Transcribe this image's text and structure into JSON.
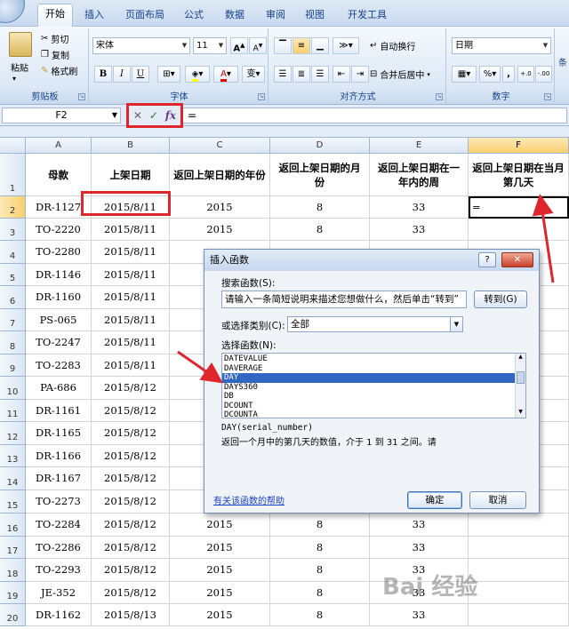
{
  "tabs": [
    "开始",
    "插入",
    "页面布局",
    "公式",
    "数据",
    "审阅",
    "视图",
    "开发工具"
  ],
  "ribbon": {
    "clipboard": {
      "paste": "粘贴",
      "cut": "剪切",
      "copy": "复制",
      "format_painter": "格式刷",
      "label": "剪贴板"
    },
    "font": {
      "name": "宋体",
      "size": "11",
      "bold": "B",
      "italic": "I",
      "underline": "U",
      "grow": "A",
      "shrink": "A",
      "wen": "变",
      "label": "字体"
    },
    "alignment": {
      "wrap": "自动换行",
      "merge": "合并后居中",
      "label": "对齐方式"
    },
    "number": {
      "format": "日期",
      "percent": "%",
      "comma": ",",
      "inc": "+.0",
      "dec": "-.00",
      "label": "数字"
    },
    "more": "条"
  },
  "formula_bar": {
    "cell_ref": "F2",
    "cancel": "✕",
    "enter": "✓",
    "fx": "fx",
    "formula": "="
  },
  "columns": [
    "A",
    "B",
    "C",
    "D",
    "E",
    "F"
  ],
  "headers": [
    "母款",
    "上架日期",
    "返回上架日期的年份",
    "返回上架日期的月份",
    "返回上架日期在一年内的周",
    "返回上架日期在当月第几天"
  ],
  "rows": [
    {
      "n": "1"
    },
    {
      "n": "2",
      "a": "DR-1127",
      "b": "2015/8/11",
      "c": "2015",
      "d": "8",
      "e": "33",
      "f": "="
    },
    {
      "n": "3",
      "a": "TO-2220",
      "b": "2015/8/11",
      "c": "2015",
      "d": "8",
      "e": "33",
      "f": ""
    },
    {
      "n": "4",
      "a": "TO-2280",
      "b": "2015/8/11"
    },
    {
      "n": "5",
      "a": "DR-1146",
      "b": "2015/8/11"
    },
    {
      "n": "6",
      "a": "DR-1160",
      "b": "2015/8/11"
    },
    {
      "n": "7",
      "a": "PS-065",
      "b": "2015/8/11"
    },
    {
      "n": "8",
      "a": "TO-2247",
      "b": "2015/8/11"
    },
    {
      "n": "9",
      "a": "TO-2283",
      "b": "2015/8/11"
    },
    {
      "n": "10",
      "a": "PA-686",
      "b": "2015/8/12"
    },
    {
      "n": "11",
      "a": "DR-1161",
      "b": "2015/8/12"
    },
    {
      "n": "12",
      "a": "DR-1165",
      "b": "2015/8/12"
    },
    {
      "n": "13",
      "a": "DR-1166",
      "b": "2015/8/12"
    },
    {
      "n": "14",
      "a": "DR-1167",
      "b": "2015/8/12"
    },
    {
      "n": "15",
      "a": "TO-2273",
      "b": "2015/8/12"
    },
    {
      "n": "16",
      "a": "TO-2284",
      "b": "2015/8/12",
      "c": "2015",
      "d": "8",
      "e": "33"
    },
    {
      "n": "17",
      "a": "TO-2286",
      "b": "2015/8/12",
      "c": "2015",
      "d": "8",
      "e": "33"
    },
    {
      "n": "18",
      "a": "TO-2293",
      "b": "2015/8/12",
      "c": "2015",
      "d": "8",
      "e": "33"
    },
    {
      "n": "19",
      "a": "JE-352",
      "b": "2015/8/12",
      "c": "2015",
      "d": "8",
      "e": "33"
    },
    {
      "n": "20",
      "a": "DR-1162",
      "b": "2015/8/13",
      "c": "2015",
      "d": "8",
      "e": "33"
    }
  ],
  "dialog": {
    "title": "插入函数",
    "help_btn": "?",
    "close_btn": "✕",
    "search_label": "搜索函数(S):",
    "search_value": "请输入一条简短说明来描述您想做什么，然后单击“转到”",
    "go_button": "转到(G)",
    "category_label": "或选择类别(C):",
    "category_value": "全部",
    "select_label": "选择函数(N):",
    "functions": [
      "DATEVALUE",
      "DAVERAGE",
      "DAY",
      "DAYS360",
      "DB",
      "DCOUNT",
      "DCOUNTA"
    ],
    "selected_function": "DAY",
    "signature": "DAY(serial_number)",
    "description": "返回一个月中的第几天的数值，介于 1 到 31 之间。请",
    "help_link": "有关该函数的帮助",
    "ok": "确定",
    "cancel": "取消"
  },
  "watermark": "Bai 经验",
  "colors": {
    "accent_red": "#e0262d",
    "selection": "#3166c5"
  }
}
